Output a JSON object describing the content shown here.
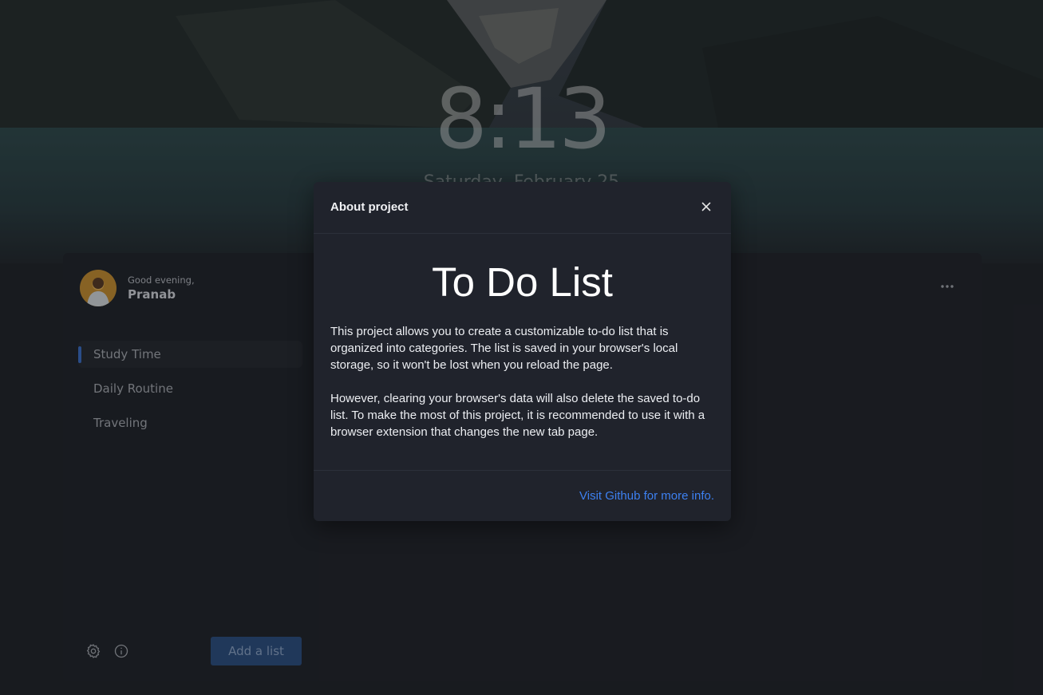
{
  "clock": {
    "time": "8:13",
    "date": "Saturday, February 25"
  },
  "user": {
    "greeting": "Good evening,",
    "name": "Pranab"
  },
  "sidebar": {
    "lists": [
      {
        "label": "Study Time",
        "active": true
      },
      {
        "label": "Daily Routine",
        "active": false
      },
      {
        "label": "Traveling",
        "active": false
      }
    ],
    "add_list_label": "Add a list",
    "icons": [
      "gear-icon",
      "info-icon"
    ]
  },
  "main": {
    "menu_icon": "more-horizontal-icon"
  },
  "modal": {
    "title": "About project",
    "heading": "To Do List",
    "paragraph_1": "This project allows you to create a customizable to-do list that is organized into categories. The list is saved in your browser's local storage, so it won't be lost when you reload the page.",
    "paragraph_2": "However, clearing your browser's data will also delete the saved to-do list. To make the most of this project, it is recommended to use it with a browser extension that changes the new tab page.",
    "link_label": "Visit Github for more info.",
    "close_icon": "close-icon"
  },
  "colors": {
    "accent": "#3b6fc9",
    "link": "#3d80f0",
    "modal_bg": "#20232c",
    "panel_bg": "#202329"
  }
}
